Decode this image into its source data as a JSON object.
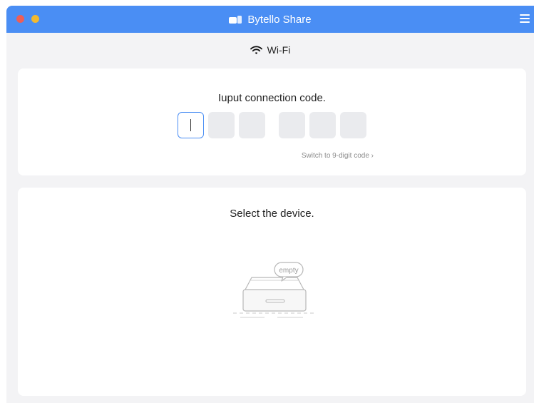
{
  "app": {
    "title": "Bytello Share"
  },
  "network": {
    "label": "Wi-Fi",
    "icon": "wifi-icon"
  },
  "connection": {
    "title": "Iuput connection code.",
    "digits": [
      "",
      "",
      "",
      "",
      "",
      ""
    ],
    "switch_label": "Switch to 9-digit code ›"
  },
  "devices": {
    "title": "Select the device.",
    "empty_label": "empty"
  },
  "colors": {
    "accent": "#4a8ef4",
    "close": "#ee5e56",
    "minimize": "#f2b931"
  }
}
